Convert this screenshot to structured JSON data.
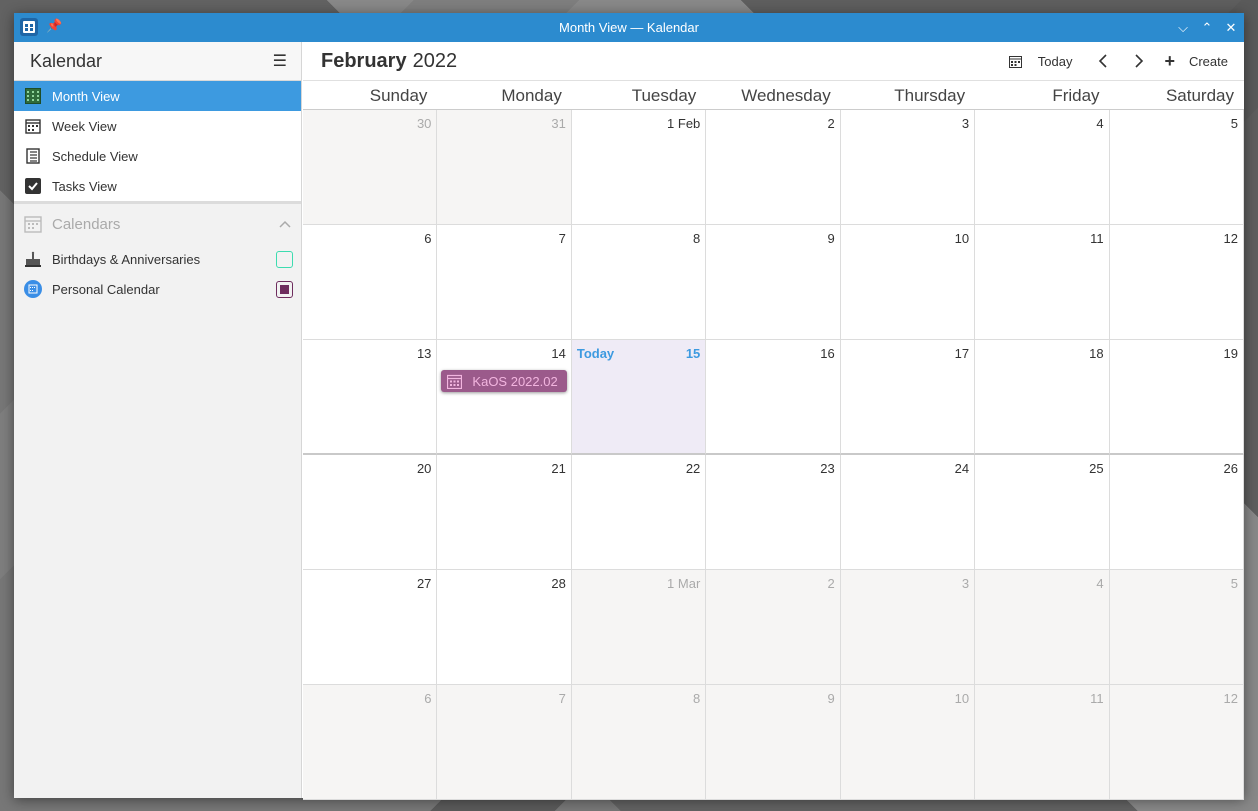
{
  "window": {
    "title": "Month View — Kalendar",
    "controls": {
      "minimize": "⌵",
      "maximize": "⌃",
      "close": "✕"
    }
  },
  "sidebar": {
    "app_title": "Kalendar",
    "views": [
      {
        "label": "Month View",
        "icon": "month-grid-icon",
        "active": true
      },
      {
        "label": "Week View",
        "icon": "week-calendar-icon",
        "active": false
      },
      {
        "label": "Schedule View",
        "icon": "schedule-list-icon",
        "active": false
      },
      {
        "label": "Tasks View",
        "icon": "checkbox-icon",
        "active": false
      }
    ],
    "calendars_label": "Calendars",
    "calendars": [
      {
        "label": "Birthdays & Anniversaries",
        "icon": "cake-icon",
        "color": "#3ddcb0",
        "checked": false
      },
      {
        "label": "Personal Calendar",
        "icon": "calendar-app-icon",
        "color": "#6e2d5e",
        "checked": true
      }
    ]
  },
  "toolbar": {
    "month": "February",
    "year": "2022",
    "today_label": "Today",
    "create_label": "Create"
  },
  "weekdays": [
    "Sunday",
    "Monday",
    "Tuesday",
    "Wednesday",
    "Thursday",
    "Friday",
    "Saturday"
  ],
  "weeks": [
    [
      {
        "d": "30",
        "out": true
      },
      {
        "d": "31",
        "out": true
      },
      {
        "d": "1 Feb"
      },
      {
        "d": "2"
      },
      {
        "d": "3"
      },
      {
        "d": "4"
      },
      {
        "d": "5"
      }
    ],
    [
      {
        "d": "6"
      },
      {
        "d": "7"
      },
      {
        "d": "8"
      },
      {
        "d": "9"
      },
      {
        "d": "10"
      },
      {
        "d": "11"
      },
      {
        "d": "12"
      }
    ],
    [
      {
        "d": "13"
      },
      {
        "d": "14"
      },
      {
        "d": "15",
        "today": true
      },
      {
        "d": "16"
      },
      {
        "d": "17"
      },
      {
        "d": "18"
      },
      {
        "d": "19"
      }
    ],
    [
      {
        "d": "20"
      },
      {
        "d": "21"
      },
      {
        "d": "22"
      },
      {
        "d": "23"
      },
      {
        "d": "24"
      },
      {
        "d": "25"
      },
      {
        "d": "26"
      }
    ],
    [
      {
        "d": "27"
      },
      {
        "d": "28"
      },
      {
        "d": "1 Mar",
        "out": true
      },
      {
        "d": "2",
        "out": true
      },
      {
        "d": "3",
        "out": true
      },
      {
        "d": "4",
        "out": true
      },
      {
        "d": "5",
        "out": true
      }
    ],
    [
      {
        "d": "6",
        "out": true
      },
      {
        "d": "7",
        "out": true
      },
      {
        "d": "8",
        "out": true
      },
      {
        "d": "9",
        "out": true
      },
      {
        "d": "10",
        "out": true
      },
      {
        "d": "11",
        "out": true
      },
      {
        "d": "12",
        "out": true
      }
    ]
  ],
  "today_label": "Today",
  "event": {
    "title": "KaOS 2022.02",
    "week": 2,
    "day": 1,
    "color": "#9b5a8b"
  },
  "colors": {
    "accent": "#3d9ae0",
    "titlebar": "#2c8bcf"
  }
}
